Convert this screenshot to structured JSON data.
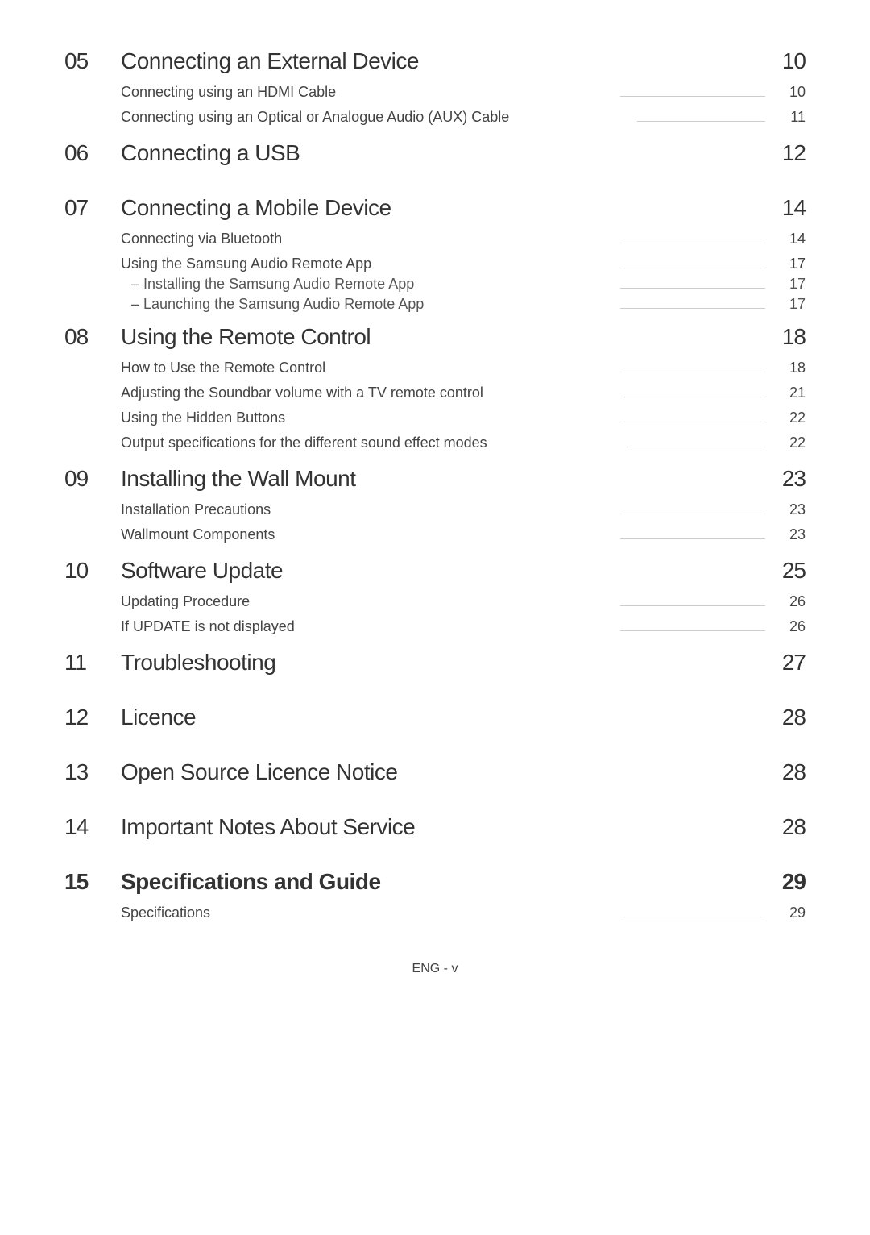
{
  "footer": "ENG - v",
  "toc": [
    {
      "number": "05",
      "title": "Connecting an External Device",
      "page": "10",
      "items": [
        {
          "label": "Connecting using an HDMI Cable",
          "page": "10"
        },
        {
          "label": "Connecting using an Optical or Analogue Audio (AUX) Cable",
          "page": "11"
        }
      ]
    },
    {
      "number": "06",
      "title": "Connecting a USB",
      "page": "12",
      "items": []
    },
    {
      "number": "07",
      "title": "Connecting a Mobile Device",
      "page": "14",
      "items": [
        {
          "label": "Connecting via Bluetooth",
          "page": "14"
        },
        {
          "label": "Using the Samsung Audio Remote App",
          "page": "17",
          "subs": [
            {
              "label": "Installing the Samsung Audio Remote App",
              "page": "17"
            },
            {
              "label": "Launching the Samsung Audio Remote App",
              "page": "17"
            }
          ]
        }
      ]
    },
    {
      "number": "08",
      "title": "Using the Remote Control",
      "page": "18",
      "items": [
        {
          "label": "How to Use the Remote Control",
          "page": "18"
        },
        {
          "label": "Adjusting the Soundbar volume with a TV remote control",
          "page": "21"
        },
        {
          "label": "Using the Hidden Buttons",
          "page": "22"
        },
        {
          "label": "Output specifications for the different sound effect modes",
          "page": "22"
        }
      ]
    },
    {
      "number": "09",
      "title": "Installing the Wall Mount",
      "page": "23",
      "items": [
        {
          "label": "Installation Precautions",
          "page": "23"
        },
        {
          "label": "Wallmount Components",
          "page": "23"
        }
      ]
    },
    {
      "number": "10",
      "title": "Software Update",
      "page": "25",
      "items": [
        {
          "label": "Updating Procedure",
          "page": "26"
        },
        {
          "label": "If UPDATE is not displayed",
          "page": "26"
        }
      ]
    },
    {
      "number": "11",
      "title": "Troubleshooting",
      "page": "27",
      "items": []
    },
    {
      "number": "12",
      "title": "Licence",
      "page": "28",
      "items": []
    },
    {
      "number": "13",
      "title": "Open Source Licence Notice",
      "page": "28",
      "items": []
    },
    {
      "number": "14",
      "title": "Important Notes About Service",
      "page": "28",
      "items": []
    },
    {
      "number": "15",
      "title": "Specifications and Guide",
      "page": "29",
      "bold": true,
      "items": [
        {
          "label": "Specifications",
          "page": "29"
        }
      ]
    }
  ]
}
